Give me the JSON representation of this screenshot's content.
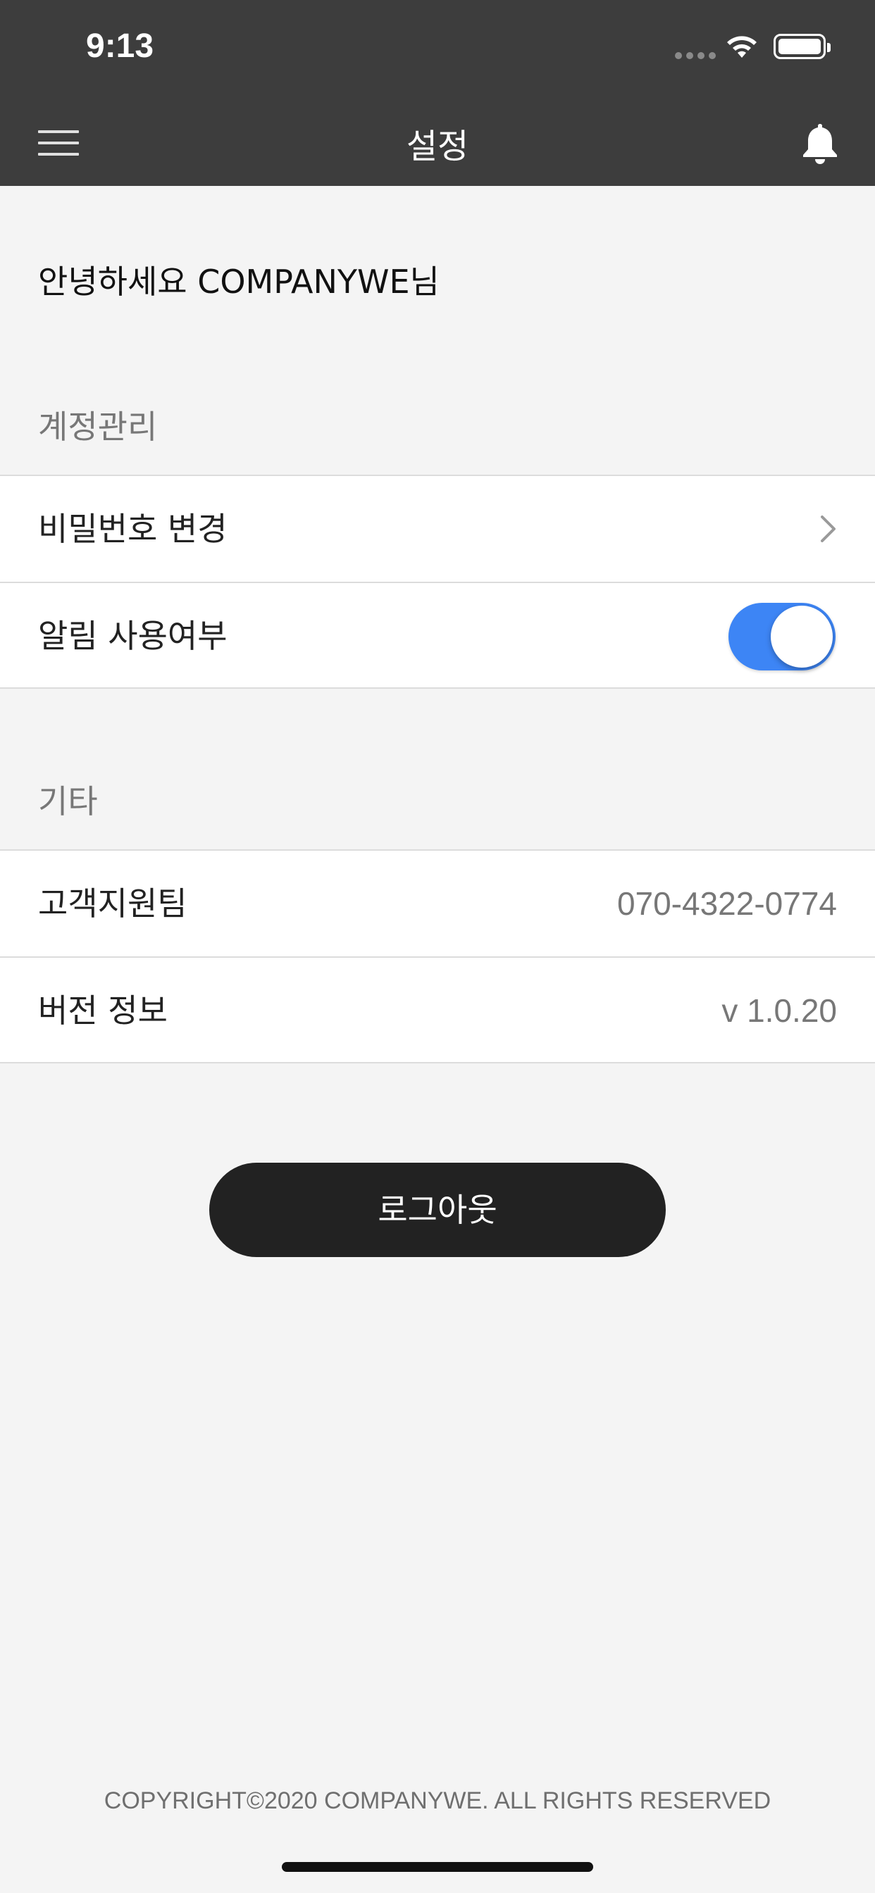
{
  "status_bar": {
    "time": "9:13"
  },
  "nav": {
    "title": "설정",
    "menu_icon": "hamburger-menu-icon",
    "bell_icon": "bell-icon"
  },
  "greeting": "안녕하세요 COMPANYWE님",
  "sections": {
    "account": {
      "header": "계정관리",
      "change_password_label": "비밀번호 변경",
      "notification_label": "알림 사용여부",
      "notification_enabled": true
    },
    "etc": {
      "header": "기타",
      "support_label": "고객지원팀",
      "support_value": "070-4322-0774",
      "version_label": "버전 정보",
      "version_value": "v 1.0.20"
    }
  },
  "logout_label": "로그아웃",
  "copyright": "COPYRIGHT©2020 COMPANYWE. ALL RIGHTS RESERVED",
  "colors": {
    "header_bg": "#3d3d3d",
    "toggle_on": "#3d85f5",
    "button_bg": "#222222",
    "page_bg": "#f4f4f4"
  }
}
